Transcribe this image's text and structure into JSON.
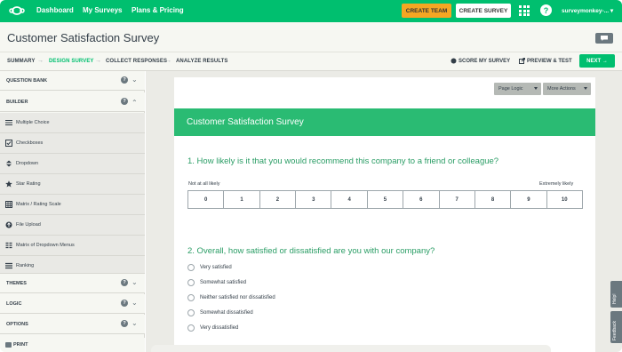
{
  "topnav": {
    "links": [
      "Dashboard",
      "My Surveys",
      "Plans & Pricing"
    ],
    "create_team": "CREATE TEAM",
    "create_survey": "CREATE SURVEY",
    "help": "?",
    "user": "surveymonkey-..."
  },
  "titlebar": {
    "title": "Customer Satisfaction Survey"
  },
  "subnav": {
    "steps": [
      "SUMMARY",
      "DESIGN SURVEY",
      "COLLECT RESPONSES",
      "ANALYZE RESULTS"
    ],
    "arrow": "→",
    "score": "SCORE MY SURVEY",
    "preview": "PREVIEW & TEST",
    "next": "NEXT →"
  },
  "sidebar": {
    "question_bank": "QUESTION BANK",
    "builder": "BUILDER",
    "items": [
      "Multiple Choice",
      "Checkboxes",
      "Dropdown",
      "Star Rating",
      "Matrix / Rating Scale",
      "File Upload",
      "Matrix of Dropdown Menus",
      "Ranking"
    ],
    "themes": "THEMES",
    "logic": "LOGIC",
    "options": "OPTIONS",
    "print": "PRINT",
    "help_glyph": "?"
  },
  "canvas": {
    "page_logic": "Page Logic",
    "more_actions": "More Actions",
    "header": "Customer Satisfaction Survey",
    "q1": "1. How likely is it that you would recommend this company to a friend or colleague?",
    "scale_low": "Not at all likely",
    "scale_high": "Extremely likely",
    "scale": [
      "0",
      "1",
      "2",
      "3",
      "4",
      "5",
      "6",
      "7",
      "8",
      "9",
      "10"
    ],
    "q2": "2. Overall, how satisfied or dissatisfied are you with our company?",
    "options": [
      "Very satisfied",
      "Somewhat satisfied",
      "Neither satisfied nor dissatisfied",
      "Somewhat dissatisfied",
      "Very dissatisfied"
    ]
  },
  "side_tabs": {
    "help": "Help!",
    "feedback": "Feedback"
  },
  "colors": {
    "brand": "#00bf6f",
    "accent": "#f5a623",
    "question": "#2a9d65"
  }
}
